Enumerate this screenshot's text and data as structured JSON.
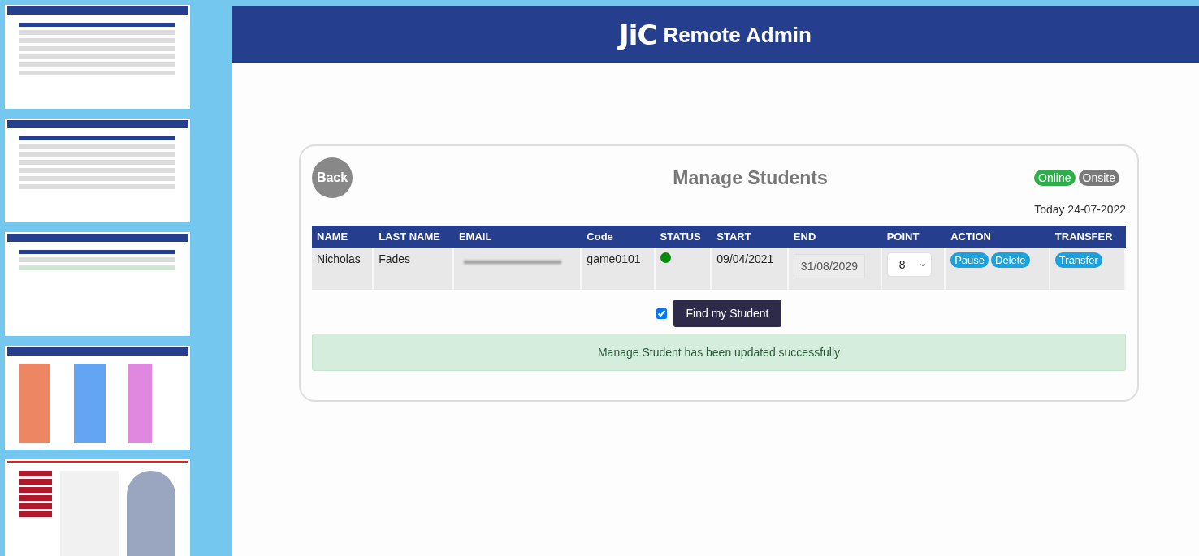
{
  "thumbnails": [
    {
      "kind": "table"
    },
    {
      "kind": "dialog"
    },
    {
      "kind": "alert"
    },
    {
      "kind": "calendar"
    },
    {
      "kind": "menu"
    }
  ],
  "header": {
    "logo": "JiC",
    "title": "Remote Admin"
  },
  "card": {
    "back": "Back",
    "title": "Manage Students",
    "badges": [
      {
        "label": "Online",
        "color": "#2eae4a"
      },
      {
        "label": "Onsite",
        "color": "#7a7a7a"
      }
    ],
    "date": "Today 24-07-2022"
  },
  "table": {
    "columns": [
      "NAME",
      "LAST NAME",
      "EMAIL",
      "Code",
      "STATUS",
      "START",
      "END",
      "POINT",
      "ACTION",
      "TRANSFER"
    ],
    "rows": [
      {
        "name": "Nicholas",
        "last_name": "Fades",
        "code": "game0101",
        "status": {
          "color": "#0a8a0a"
        },
        "start": "09/04/2021",
        "end": "31/08/2029",
        "point": "8",
        "actions": [
          "Pause",
          "Delete"
        ],
        "transfer": "Transfer"
      }
    ]
  },
  "find": {
    "checked": true,
    "button": "Find my Student"
  },
  "alert": "Manage Student has been updated successfully"
}
